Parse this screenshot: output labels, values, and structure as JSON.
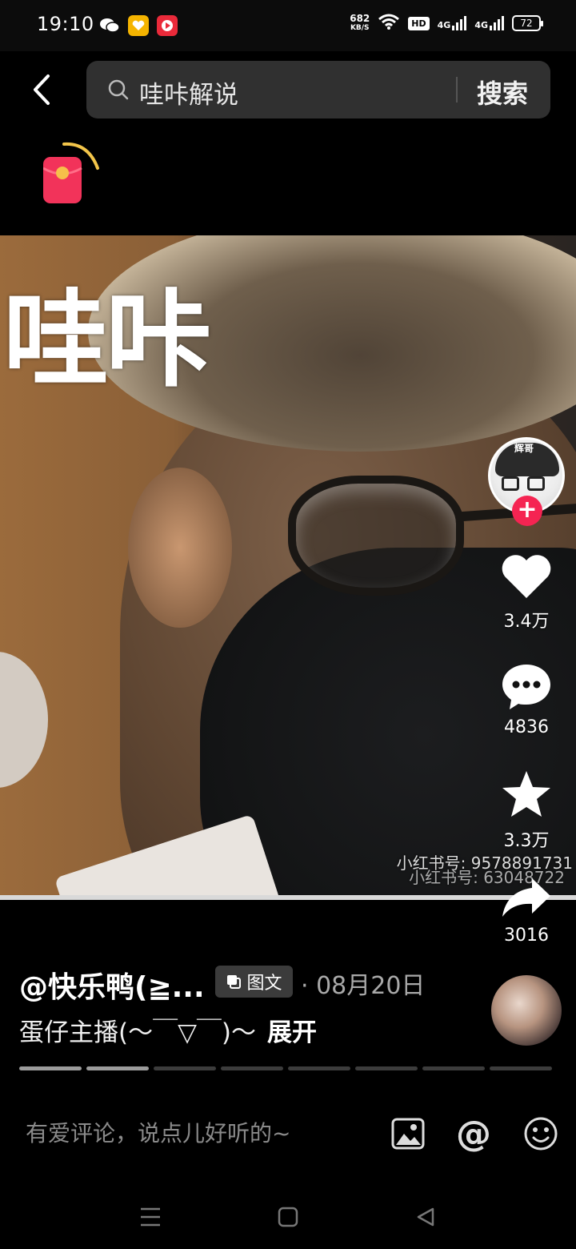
{
  "status_bar": {
    "time": "19:10",
    "net_speed_value": "682",
    "net_speed_unit": "KB/S",
    "hd_label": "HD",
    "signal1_label": "4G",
    "signal2_label": "4G",
    "battery": "72"
  },
  "search": {
    "query": "哇咔解说",
    "button_label": "搜索"
  },
  "video": {
    "overlay_title": "哇咔",
    "watermark_1": "小红书号: 9578891731",
    "watermark_2": "小红书号: 63048722"
  },
  "actions": {
    "avatar_tag": "辉哥",
    "follow_symbol": "+",
    "likes": "3.4万",
    "comments": "4836",
    "favorites": "3.3万",
    "shares": "3016"
  },
  "post": {
    "author": "@快乐鸭(≧...",
    "type_badge": "图文",
    "date": "· 08月20日",
    "description": "蛋仔主播(～￣▽￣)～",
    "expand_label": "展开",
    "progress": {
      "total": 8,
      "active": 2
    }
  },
  "comment_bar": {
    "placeholder": "有爱评论，说点儿好听的~",
    "at_symbol": "@"
  },
  "colors": {
    "accent": "#f52452",
    "background": "#000000",
    "search_bg": "#303030"
  },
  "icons": [
    "back-icon",
    "search-icon",
    "red-envelope-icon",
    "heart-icon",
    "comment-icon",
    "star-icon",
    "share-icon",
    "image-icon",
    "at-icon",
    "emoji-icon",
    "menu-icon",
    "home-icon",
    "back-triangle-icon"
  ]
}
